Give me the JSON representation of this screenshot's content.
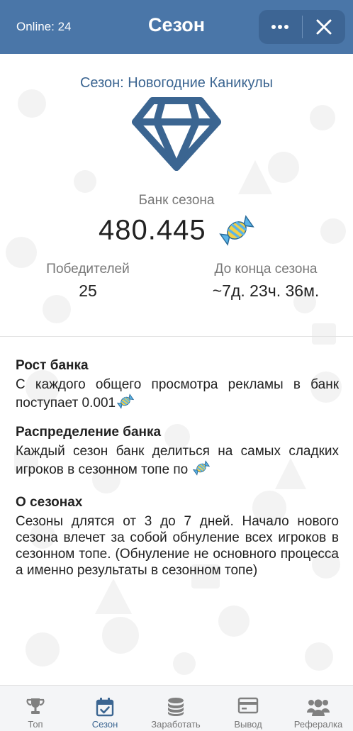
{
  "header": {
    "online": "Online: 24",
    "title": "Сезон"
  },
  "season": {
    "name": "Сезон: Новогодние Каникулы",
    "bank_label": "Банк сезона",
    "bank_value": "480.445",
    "winners_label": "Победителей",
    "winners_value": "25",
    "ends_label": "До конца сезона",
    "ends_value": "~7д. 23ч. 36м."
  },
  "info": [
    {
      "title": "Рост банка",
      "text": "С каждого общего просмотра рекламы в банк поступает 0.001"
    },
    {
      "title": "Распределение банка",
      "text": "Каждый сезон банк делиться на самых сладких игроков в сезонном топе по"
    },
    {
      "title": "О сезонах",
      "text": "Сезоны длятся от 3 до 7 дней. Начало нового сезона влечет за собой обнуление всех игроков в сезонном топе. (Обнуление не основного процесса а именно результаты в сезонном топе)"
    }
  ],
  "nav": [
    {
      "label": "Топ",
      "icon": "trophy-icon"
    },
    {
      "label": "Сезон",
      "icon": "calendar-check-icon",
      "active": true
    },
    {
      "label": "Заработать",
      "icon": "coins-stack-icon"
    },
    {
      "label": "Вывод",
      "icon": "credit-card-icon"
    },
    {
      "label": "Рефералка",
      "icon": "users-icon"
    }
  ],
  "colors": {
    "header_bg": "#4a76a8",
    "accent": "#3b6591",
    "candy_blue": "#5ab4e8",
    "candy_yellow": "#f2d048"
  }
}
